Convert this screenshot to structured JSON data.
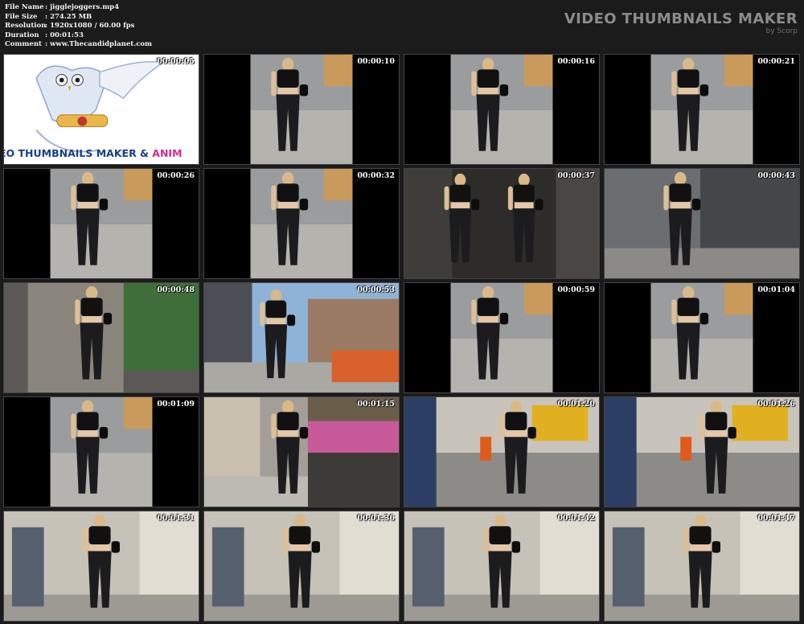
{
  "meta": {
    "file_name_label": "File Name",
    "file_name_value": ":  jigglejoggers.mp4",
    "file_size_label": "File Size",
    "file_size_value": ":  274.25 MB",
    "resolution_label": "Resolution",
    "resolution_value": ":  1920x1080 / 60.00 fps",
    "duration_label": "Duration",
    "duration_value": ":  00:01:53",
    "comment_label": "Comment",
    "comment_value": ":  www.Thecandidplanet.com"
  },
  "brand": {
    "title": "VIDEO THUMBNAILS MAKER",
    "subtitle": "by Scorp"
  },
  "intro": {
    "banner_main": "EO THUMBNAILS MAKER & ",
    "banner_accent": "ANIM"
  },
  "thumbnails": [
    {
      "timestamp": "00:00:05",
      "scene": "intro"
    },
    {
      "timestamp": "00:00:10",
      "scene": "street-pillar"
    },
    {
      "timestamp": "00:00:16",
      "scene": "street-pillar"
    },
    {
      "timestamp": "00:00:21",
      "scene": "street-pillar"
    },
    {
      "timestamp": "00:00:26",
      "scene": "street-pillar"
    },
    {
      "timestamp": "00:00:32",
      "scene": "street-pillar"
    },
    {
      "timestamp": "00:00:37",
      "scene": "shadow"
    },
    {
      "timestamp": "00:00:43",
      "scene": "gate"
    },
    {
      "timestamp": "00:00:48",
      "scene": "planter"
    },
    {
      "timestamp": "00:00:53",
      "scene": "city-front"
    },
    {
      "timestamp": "00:00:59",
      "scene": "street-pillar"
    },
    {
      "timestamp": "00:01:04",
      "scene": "street-pillar"
    },
    {
      "timestamp": "00:01:09",
      "scene": "street-pillar"
    },
    {
      "timestamp": "00:01:15",
      "scene": "flowers"
    },
    {
      "timestamp": "00:01:20",
      "scene": "construction"
    },
    {
      "timestamp": "00:01:26",
      "scene": "construction"
    },
    {
      "timestamp": "00:01:31",
      "scene": "soho"
    },
    {
      "timestamp": "00:01:36",
      "scene": "soho"
    },
    {
      "timestamp": "00:01:42",
      "scene": "soho"
    },
    {
      "timestamp": "00:01:47",
      "scene": "soho"
    }
  ]
}
